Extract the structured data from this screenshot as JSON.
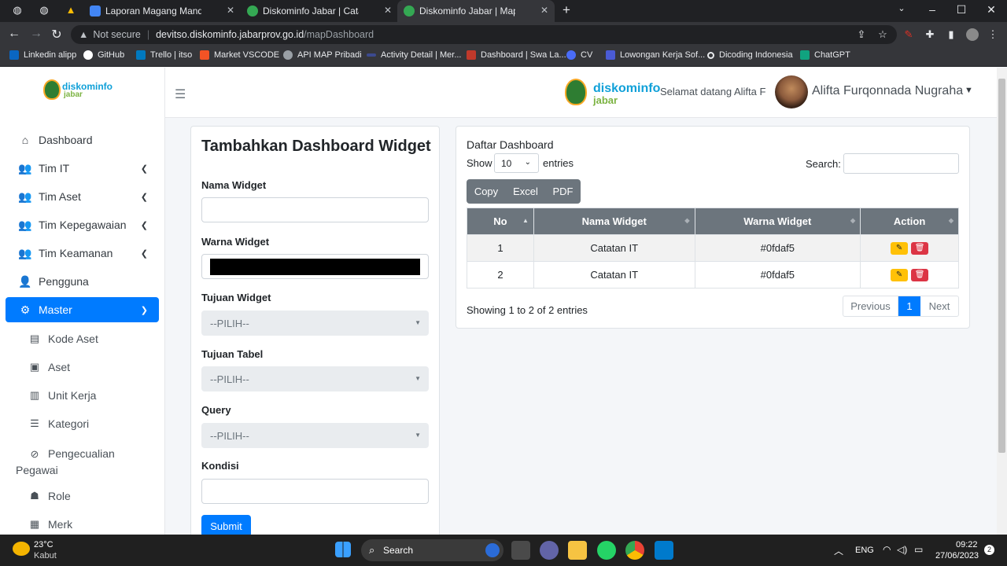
{
  "browser": {
    "tabs": [
      {
        "title": "Laporan Magang Mandiri.docx -",
        "color": "#4285f4",
        "active": false
      },
      {
        "title": "Diskominfo Jabar | Catatan IT",
        "color": "#34a853",
        "active": false
      },
      {
        "title": "Diskominfo Jabar | Mapping Das",
        "color": "#34a853",
        "active": true
      }
    ],
    "security_label": "Not secure",
    "url_host": "devitso.diskominfo.jabarprov.go.id",
    "url_path": "/mapDashboard",
    "bookmarks": [
      {
        "label": "Linkedin alipp",
        "color": "#0a66c2"
      },
      {
        "label": "GitHub",
        "color": "#ffffff"
      },
      {
        "label": "Trello | itso",
        "color": "#0079bf"
      },
      {
        "label": "Market VSCODE",
        "color": "#f35325"
      },
      {
        "label": "API MAP Pribadi",
        "color": "#9aa0a6"
      },
      {
        "label": "Activity Detail | Mer...",
        "color": "#3c4a8f"
      },
      {
        "label": "Dashboard | Swa La...",
        "color": "#c0392b"
      },
      {
        "label": "CV",
        "color": "#4a6cf7"
      },
      {
        "label": "Lowongan Kerja Sof...",
        "color": "#4a5bd4"
      },
      {
        "label": "Dicoding Indonesia",
        "color": "#e8eaed"
      },
      {
        "label": "ChatGPT",
        "color": "#10a37f"
      }
    ]
  },
  "brand": {
    "logo_top": "diskominfo",
    "logo_bottom": "jabar"
  },
  "header": {
    "welcome": "Selamat datang Alifta F",
    "user_name": "Alifta Furqonnada Nugraha"
  },
  "sidebar": {
    "items": [
      {
        "label": "Dashboard",
        "icon": "home-icon",
        "glyph": "⌂",
        "expandable": false,
        "active": false
      },
      {
        "label": "Tim IT",
        "icon": "users-icon",
        "glyph": "👥",
        "expandable": true,
        "active": false
      },
      {
        "label": "Tim Aset",
        "icon": "users-icon",
        "glyph": "👥",
        "expandable": true,
        "active": false
      },
      {
        "label": "Tim Kepegawaian",
        "icon": "users-icon",
        "glyph": "👥",
        "expandable": true,
        "active": false
      },
      {
        "label": "Tim Keamanan",
        "icon": "users-icon",
        "glyph": "👥",
        "expandable": true,
        "active": false
      },
      {
        "label": "Pengguna",
        "icon": "user-plus-icon",
        "glyph": "👤",
        "expandable": false,
        "active": false
      },
      {
        "label": "Master",
        "icon": "gear-icon",
        "glyph": "⚙",
        "expandable": true,
        "active": true
      }
    ],
    "subitems": [
      {
        "label": "Kode Aset",
        "icon": "book-icon",
        "glyph": "▤"
      },
      {
        "label": "Aset",
        "icon": "clipboard-icon",
        "glyph": "▣"
      },
      {
        "label": "Unit Kerja",
        "icon": "building-icon",
        "glyph": "▥"
      },
      {
        "label": "Kategori",
        "icon": "list-icon",
        "glyph": "☰"
      },
      {
        "label": "Pengecualian Pegawai",
        "icon": "ban-icon",
        "glyph": "⊘"
      },
      {
        "label": "Role",
        "icon": "user-role-icon",
        "glyph": "☗"
      },
      {
        "label": "Merk",
        "icon": "tag-icon",
        "glyph": "▦"
      }
    ]
  },
  "form": {
    "title": "Tambahkan Dashboard Widget",
    "nama_widget_label": "Nama Widget",
    "nama_widget_value": "",
    "warna_widget_label": "Warna Widget",
    "warna_widget_value": "#000000",
    "tujuan_widget_label": "Tujuan Widget",
    "tujuan_widget_value": "--PILIH--",
    "tujuan_tabel_label": "Tujuan Tabel",
    "tujuan_tabel_value": "--PILIH--",
    "query_label": "Query",
    "query_value": "--PILIH--",
    "kondisi_label": "Kondisi",
    "kondisi_value": "",
    "submit_label": "Submit"
  },
  "table_card": {
    "title": "Daftar Dashboard",
    "show_label": "Show",
    "show_value": "10",
    "entries_label": "entries",
    "search_label": "Search:",
    "search_value": "",
    "export_buttons": [
      "Copy",
      "Excel",
      "PDF"
    ],
    "columns": [
      "No",
      "Nama Widget",
      "Warna Widget",
      "Action"
    ],
    "rows": [
      {
        "no": "1",
        "nama": "Catatan IT",
        "warna": "#0fdaf5"
      },
      {
        "no": "2",
        "nama": "Catatan IT",
        "warna": "#0fdaf5"
      }
    ],
    "info": "Showing 1 to 2 of 2 entries",
    "pager": {
      "previous": "Previous",
      "current": "1",
      "next": "Next"
    }
  },
  "taskbar": {
    "weather_temp": "23°C",
    "weather_desc": "Kabut",
    "search_placeholder": "Search",
    "lang": "ENG",
    "time": "09:22",
    "date": "27/06/2023",
    "notif_count": "2"
  },
  "colors": {
    "primary": "#007bff",
    "secondary": "#6c757d",
    "warning": "#ffc107",
    "danger": "#dc3545"
  }
}
